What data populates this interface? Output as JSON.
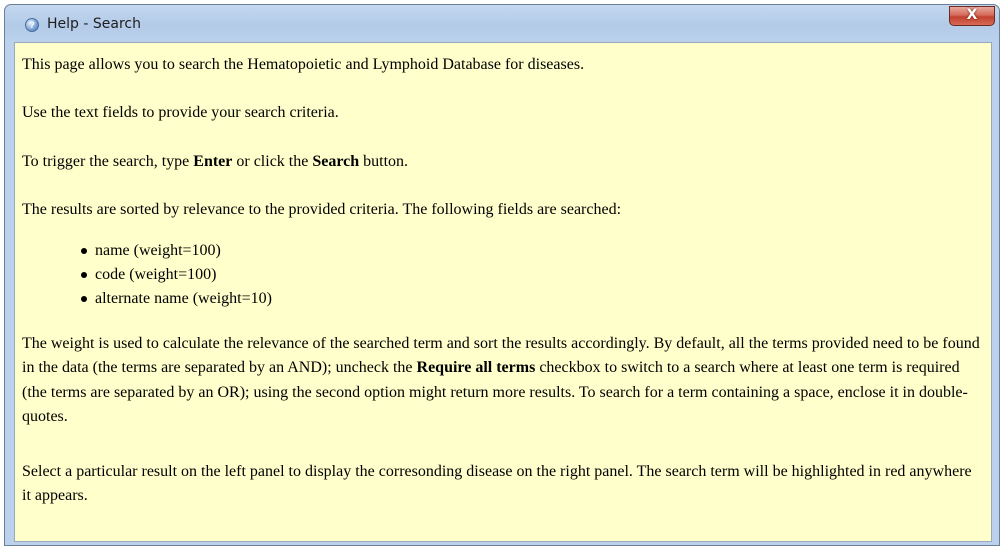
{
  "window": {
    "title": "Help - Search",
    "close_label": "X"
  },
  "content": {
    "intro": "This page allows you to search the Hematopoietic and Lymphoid Database for diseases.",
    "fields_hint": "Use the text fields to provide your search criteria.",
    "trigger": {
      "prefix": "To trigger the search, type ",
      "enter": "Enter",
      "middle": " or click the ",
      "search": "Search",
      "suffix": " button."
    },
    "results_intro": "The results are sorted by relevance to the provided criteria. The following fields are searched:",
    "searched_fields": [
      "name (weight=100)",
      "code (weight=100)",
      "alternate name (weight=10)"
    ],
    "weight_paragraph": {
      "part1": "The weight is used to calculate the relevance of the searched term and sort the results accordingly. By default, all the terms provided need to be found in the data (the terms are separated by an AND); uncheck the ",
      "bold": "Require all terms",
      "part2": " checkbox to switch to a search where at least one term is required (the terms are separated by an OR); using the second option might return more results. To search for a term containing a space, enclose it in double-quotes."
    },
    "select_paragraph": "Select a particular result on the left panel to display the corresonding disease on the right panel. The search term will be highlighted in red anywhere it appears."
  }
}
